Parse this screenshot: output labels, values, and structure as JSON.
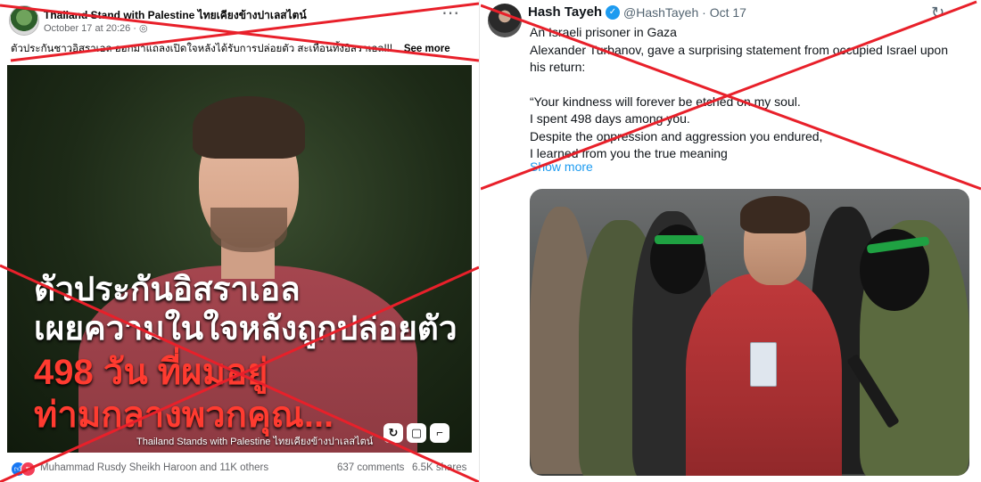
{
  "facebook_post": {
    "page_name": "Thailand Stand with Palestine ไทยเคียงข้างปาเลสไตน์",
    "timestamp": "October 17 at 20:26 ·",
    "caption": "ตัวประกันชาวอิสราเอล ออกมาแถลงเปิดใจหลังได้รับการปล่อยตัว สะเทือนทั้งอิสราเอล!!!...",
    "see_more": "See more",
    "overlay_lines": [
      "ตัวประกันอิสราเอล",
      "เผยความในใจหลังถูกปล่อยตัว",
      "498 วัน ที่ผมอยู่",
      "ท่ามกลางพวกคุณ..."
    ],
    "watermark": "Thailand Stands with Palestine ไทยเคียงข้างปาเลสไตน์",
    "reactors": "Muhammad Rusdy Sheikh Haroon and 11K others",
    "comments": "637 comments",
    "shares": "6.5K shares"
  },
  "tweet": {
    "display_name": "Hash Tayeh",
    "handle_date": "@HashTayeh · Oct 17",
    "lines": [
      "An Israeli prisoner in Gaza",
      "Alexander Turbanov, gave a surprising statement from occupied Israel upon",
      "his return:",
      "",
      "“Your kindness will forever be etched on my soul.",
      "I spent 498 days among you.",
      "Despite the oppression and aggression you endured,",
      "I learned from you the true meaning"
    ],
    "show_more": "Show more"
  },
  "colors": {
    "cross_red": "#e8202a",
    "fb_blue": "#1877f2",
    "twitter_blue": "#1d9bf0",
    "overlay_red": "#ff3b30"
  },
  "icons": [
    "more-icon",
    "globe-icon",
    "verified-badge-icon",
    "refresh-icon",
    "like-reaction-icon",
    "love-reaction-icon"
  ]
}
